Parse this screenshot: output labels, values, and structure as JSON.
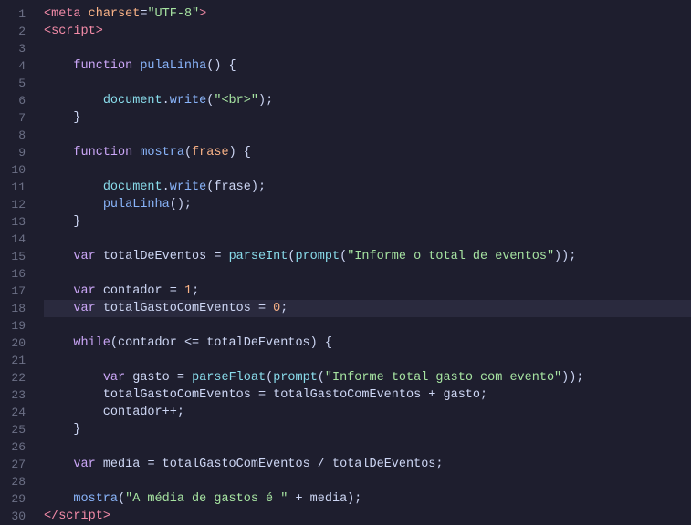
{
  "editor": {
    "background": "#1e1e2e",
    "lineHeight": 19,
    "lines": [
      {
        "num": 1,
        "tokens": [
          {
            "t": "<",
            "c": "kw-tag"
          },
          {
            "t": "meta",
            "c": "kw-tag"
          },
          {
            "t": " charset",
            "c": "kw-attr"
          },
          {
            "t": "=",
            "c": "op"
          },
          {
            "t": "\"UTF-8\"",
            "c": "kw-val"
          },
          {
            "t": ">",
            "c": "kw-tag"
          }
        ]
      },
      {
        "num": 2,
        "tokens": [
          {
            "t": "<",
            "c": "kw-tag"
          },
          {
            "t": "script",
            "c": "kw-tag"
          },
          {
            "t": ">",
            "c": "kw-tag"
          }
        ]
      },
      {
        "num": 3,
        "tokens": []
      },
      {
        "num": 4,
        "tokens": [
          {
            "t": "    ",
            "c": "plain"
          },
          {
            "t": "function",
            "c": "kw-js"
          },
          {
            "t": " ",
            "c": "plain"
          },
          {
            "t": "pulaLinha",
            "c": "fn-name"
          },
          {
            "t": "() {",
            "c": "punct"
          }
        ]
      },
      {
        "num": 5,
        "tokens": []
      },
      {
        "num": 6,
        "tokens": [
          {
            "t": "        ",
            "c": "plain"
          },
          {
            "t": "document",
            "c": "builtin"
          },
          {
            "t": ".",
            "c": "punct"
          },
          {
            "t": "write",
            "c": "method"
          },
          {
            "t": "(",
            "c": "punct"
          },
          {
            "t": "\"<br>\"",
            "c": "str"
          },
          {
            "t": ");",
            "c": "punct"
          }
        ]
      },
      {
        "num": 7,
        "tokens": [
          {
            "t": "    ",
            "c": "plain"
          },
          {
            "t": "}",
            "c": "punct"
          }
        ]
      },
      {
        "num": 8,
        "tokens": []
      },
      {
        "num": 9,
        "tokens": [
          {
            "t": "    ",
            "c": "plain"
          },
          {
            "t": "function",
            "c": "kw-js"
          },
          {
            "t": " ",
            "c": "plain"
          },
          {
            "t": "mostra",
            "c": "fn-name"
          },
          {
            "t": "(",
            "c": "punct"
          },
          {
            "t": "frase",
            "c": "param"
          },
          {
            "t": ") {",
            "c": "punct"
          }
        ]
      },
      {
        "num": 10,
        "tokens": []
      },
      {
        "num": 11,
        "tokens": [
          {
            "t": "        ",
            "c": "plain"
          },
          {
            "t": "document",
            "c": "builtin"
          },
          {
            "t": ".",
            "c": "punct"
          },
          {
            "t": "write",
            "c": "method"
          },
          {
            "t": "(frase);",
            "c": "punct"
          }
        ]
      },
      {
        "num": 12,
        "tokens": [
          {
            "t": "        ",
            "c": "plain"
          },
          {
            "t": "pulaLinha",
            "c": "fn-name"
          },
          {
            "t": "();",
            "c": "punct"
          }
        ]
      },
      {
        "num": 13,
        "tokens": [
          {
            "t": "    ",
            "c": "plain"
          },
          {
            "t": "}",
            "c": "punct"
          }
        ]
      },
      {
        "num": 14,
        "tokens": []
      },
      {
        "num": 15,
        "tokens": [
          {
            "t": "    ",
            "c": "plain"
          },
          {
            "t": "var",
            "c": "kw-js"
          },
          {
            "t": " totalDeEventos ",
            "c": "plain"
          },
          {
            "t": "=",
            "c": "op"
          },
          {
            "t": " ",
            "c": "plain"
          },
          {
            "t": "parseInt",
            "c": "builtin"
          },
          {
            "t": "(",
            "c": "punct"
          },
          {
            "t": "prompt",
            "c": "builtin"
          },
          {
            "t": "(",
            "c": "punct"
          },
          {
            "t": "\"Informe o total de eventos\"",
            "c": "str"
          },
          {
            "t": "));",
            "c": "punct"
          }
        ]
      },
      {
        "num": 16,
        "tokens": []
      },
      {
        "num": 17,
        "tokens": [
          {
            "t": "    ",
            "c": "plain"
          },
          {
            "t": "var",
            "c": "kw-js"
          },
          {
            "t": " contador ",
            "c": "plain"
          },
          {
            "t": "=",
            "c": "op"
          },
          {
            "t": " ",
            "c": "plain"
          },
          {
            "t": "1",
            "c": "num"
          },
          {
            "t": ";",
            "c": "punct"
          }
        ]
      },
      {
        "num": 18,
        "tokens": [
          {
            "t": "    ",
            "c": "plain"
          },
          {
            "t": "var",
            "c": "kw-js"
          },
          {
            "t": " totalGastoComEventos ",
            "c": "plain"
          },
          {
            "t": "=",
            "c": "op"
          },
          {
            "t": " ",
            "c": "plain"
          },
          {
            "t": "0",
            "c": "num"
          },
          {
            "t": ";",
            "c": "punct"
          }
        ],
        "highlight": true
      },
      {
        "num": 19,
        "tokens": []
      },
      {
        "num": 20,
        "tokens": [
          {
            "t": "    ",
            "c": "plain"
          },
          {
            "t": "while",
            "c": "kw-js"
          },
          {
            "t": "(contador ",
            "c": "plain"
          },
          {
            "t": "<=",
            "c": "op"
          },
          {
            "t": " totalDeEventos) {",
            "c": "plain"
          }
        ]
      },
      {
        "num": 21,
        "tokens": []
      },
      {
        "num": 22,
        "tokens": [
          {
            "t": "        ",
            "c": "plain"
          },
          {
            "t": "var",
            "c": "kw-js"
          },
          {
            "t": " gasto ",
            "c": "plain"
          },
          {
            "t": "=",
            "c": "op"
          },
          {
            "t": " ",
            "c": "plain"
          },
          {
            "t": "parseFloat",
            "c": "builtin"
          },
          {
            "t": "(",
            "c": "punct"
          },
          {
            "t": "prompt",
            "c": "builtin"
          },
          {
            "t": "(",
            "c": "punct"
          },
          {
            "t": "\"Informe total gasto com evento\"",
            "c": "str"
          },
          {
            "t": "));",
            "c": "punct"
          }
        ]
      },
      {
        "num": 23,
        "tokens": [
          {
            "t": "        totalGastoComEventos ",
            "c": "plain"
          },
          {
            "t": "=",
            "c": "op"
          },
          {
            "t": " totalGastoComEventos ",
            "c": "plain"
          },
          {
            "t": "+",
            "c": "op"
          },
          {
            "t": " gasto;",
            "c": "plain"
          }
        ]
      },
      {
        "num": 24,
        "tokens": [
          {
            "t": "        contador",
            "c": "plain"
          },
          {
            "t": "++;",
            "c": "op"
          }
        ]
      },
      {
        "num": 25,
        "tokens": [
          {
            "t": "    ",
            "c": "plain"
          },
          {
            "t": "}",
            "c": "punct"
          }
        ]
      },
      {
        "num": 26,
        "tokens": []
      },
      {
        "num": 27,
        "tokens": [
          {
            "t": "    ",
            "c": "plain"
          },
          {
            "t": "var",
            "c": "kw-js"
          },
          {
            "t": " media ",
            "c": "plain"
          },
          {
            "t": "=",
            "c": "op"
          },
          {
            "t": " totalGastoComEventos ",
            "c": "plain"
          },
          {
            "t": "/",
            "c": "op"
          },
          {
            "t": " totalDeEventos;",
            "c": "plain"
          }
        ]
      },
      {
        "num": 28,
        "tokens": []
      },
      {
        "num": 29,
        "tokens": [
          {
            "t": "    ",
            "c": "plain"
          },
          {
            "t": "mostra",
            "c": "fn-name"
          },
          {
            "t": "(",
            "c": "punct"
          },
          {
            "t": "\"A média de gastos é \"",
            "c": "str"
          },
          {
            "t": " ",
            "c": "plain"
          },
          {
            "t": "+",
            "c": "op"
          },
          {
            "t": " media);",
            "c": "plain"
          }
        ]
      },
      {
        "num": 30,
        "tokens": [
          {
            "t": "</",
            "c": "kw-tag"
          },
          {
            "t": "script",
            "c": "kw-tag"
          },
          {
            "t": ">",
            "c": "kw-tag"
          }
        ]
      }
    ]
  }
}
